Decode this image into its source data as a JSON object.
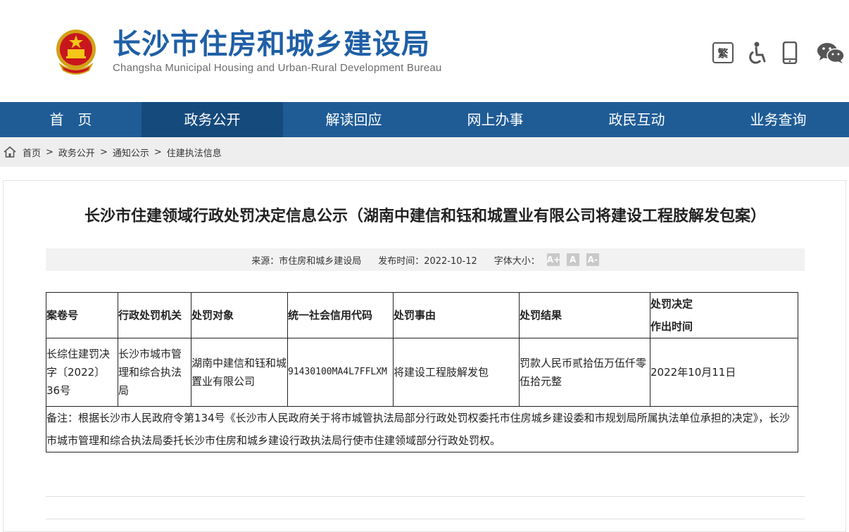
{
  "header": {
    "title": "长沙市住房和城乡建设局",
    "subtitle": "Changsha Municipal Housing and Urban-Rural Development Bureau",
    "traditional_label": "繁",
    "icons": [
      "emblem-icon",
      "traditional-chinese-icon",
      "accessibility-icon",
      "mobile-icon",
      "wechat-icon"
    ]
  },
  "nav": {
    "items": [
      {
        "label": "首　页"
      },
      {
        "label": "政务公开"
      },
      {
        "label": "解读回应"
      },
      {
        "label": "网上办事"
      },
      {
        "label": "政民互动"
      },
      {
        "label": "业务查询"
      }
    ],
    "active_index": 1
  },
  "breadcrumb": {
    "items": [
      "首页",
      "政务公开",
      "通知公示",
      "住建执法信息"
    ],
    "separator": ">"
  },
  "article": {
    "title": "长沙市住建领域行政处罚决定信息公示（湖南中建信和钰和城置业有限公司将建设工程肢解发包案）",
    "source": "来源：市住房和城乡建设局",
    "publish_time": "发布时间：2022-10-12",
    "font_size_label": "字体大小：",
    "font_buttons": [
      "A+",
      "A",
      "A-"
    ]
  },
  "table": {
    "headers": [
      "案卷号",
      "行政处罚机关",
      "处罚对象",
      "统一社会信用代码",
      "处罚事由",
      "处罚结果",
      "处罚决定作出时间"
    ],
    "header_last_line1": "处罚决定",
    "header_last_line2": "作出时间",
    "row": {
      "case_no": "长综住建罚决字〔2022〕36号",
      "authority": "长沙市城市管理和综合执法局",
      "target": "湖南中建信和钰和城置业有限公司",
      "credit_code": "91430100MA4L7FFLXM",
      "reason": "将建设工程肢解发包",
      "result": "罚款人民币贰拾伍万伍仟零伍拾元整",
      "decision_date": "2022年10月11日"
    },
    "note": "备注：根据长沙市人民政府令第134号《长沙市人民政府关于将市城管执法局部分行政处罚权委托市住房城乡建设委和市规划局所属执法单位承担的决定》，长沙市城市管理和综合执法局委托长沙市住房和城乡建设行政执法局行使市住建领域部分行政处罚权。"
  },
  "colors": {
    "nav_bg": "#1f5c96",
    "nav_active_bg": "#154a7c",
    "title_blue": "#1f5fa6",
    "breadcrumb_bg": "#eeeeee"
  }
}
